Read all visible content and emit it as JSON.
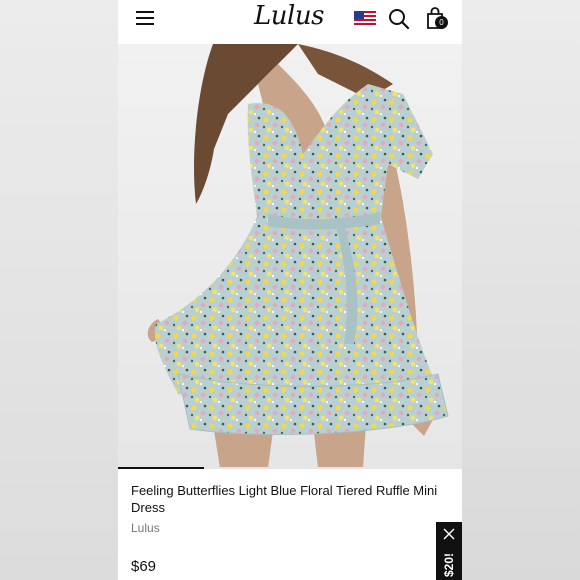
{
  "header": {
    "logo": "Lulus",
    "bag_count": "0"
  },
  "icons": {
    "menu": "hamburger-menu-icon",
    "flag": "us-flag-icon",
    "search": "search-icon",
    "bag": "shopping-bag-icon",
    "close": "close-icon"
  },
  "gallery": {
    "progress": 0.25
  },
  "product": {
    "title": "Feeling Butterflies Light Blue Floral Tiered Ruffle Mini Dress",
    "brand": "Lulus",
    "price": "$69"
  },
  "promo": {
    "label": "$20!"
  },
  "colors": {
    "dress": "#b9cfd2",
    "floral_yellow": "#f2d94a",
    "floral_pink": "#e7a7b8",
    "skin": "#c8a58a",
    "hair": "#6b4a33"
  }
}
